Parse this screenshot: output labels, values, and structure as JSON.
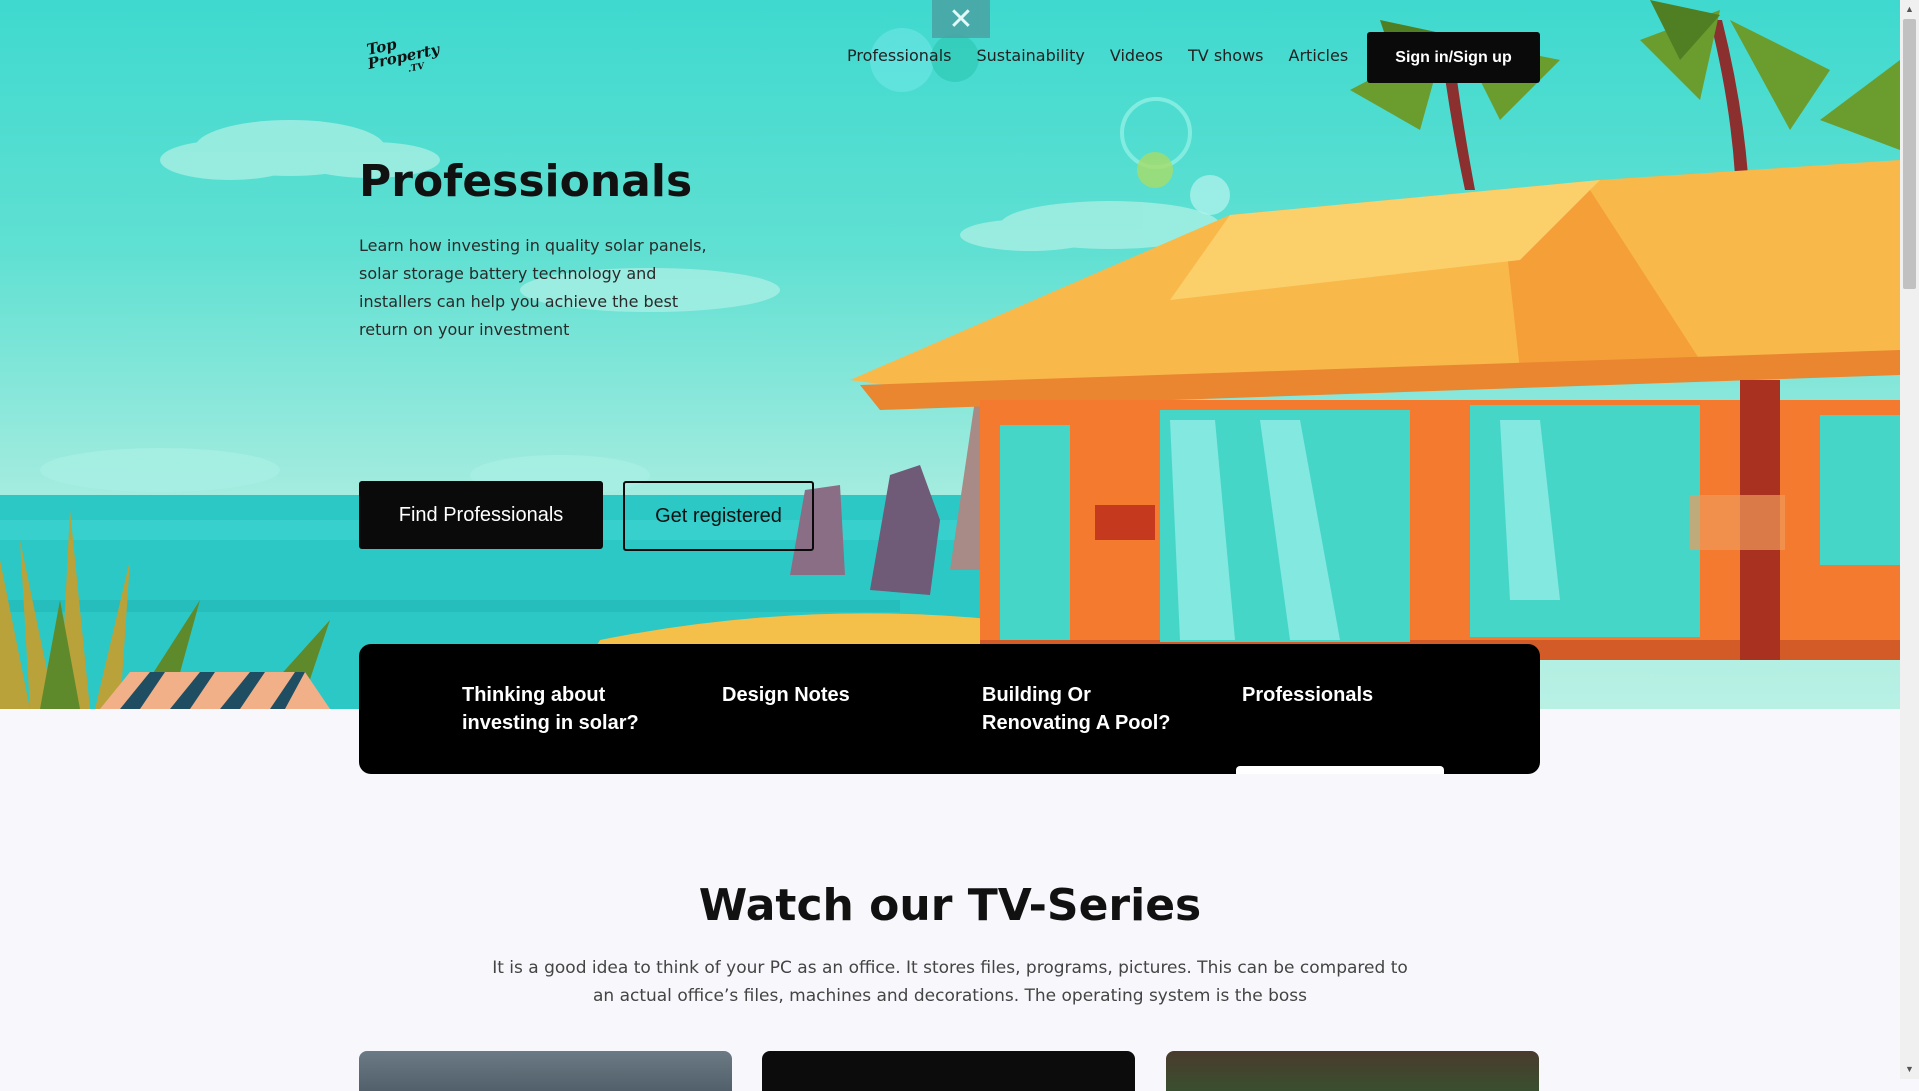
{
  "header": {
    "logo": {
      "line1": "Top",
      "line2": "Property",
      "line3": ".TV"
    },
    "nav": [
      "Professionals",
      "Sustainability",
      "Videos",
      "TV shows",
      "Articles"
    ],
    "signin_label": "Sign in/Sign up",
    "close_icon": "close-icon"
  },
  "hero": {
    "title": "Professionals",
    "description": "Learn how investing in quality solar panels, solar storage battery technology and installers can help you achieve the best return on your investment",
    "find_button": "Find Professionals",
    "register_button": "Get registered"
  },
  "tabs": [
    {
      "label": "Thinking about investing in solar?"
    },
    {
      "label": "Design Notes"
    },
    {
      "label": "Building Or Renovating A Pool?"
    },
    {
      "label": "Professionals",
      "active": true
    }
  ],
  "series": {
    "title": "Watch our TV-Series",
    "description": "It is a good idea to think of your PC as an office. It stores files, programs, pictures. This can be compared to an actual office’s files, machines and decorations. The operating system is the boss"
  },
  "colors": {
    "sky": "#3fd9cf",
    "dark": "#0a0a0a",
    "roof": "#f9b84a",
    "wall": "#f47a2f",
    "glass": "#46d6c8"
  }
}
